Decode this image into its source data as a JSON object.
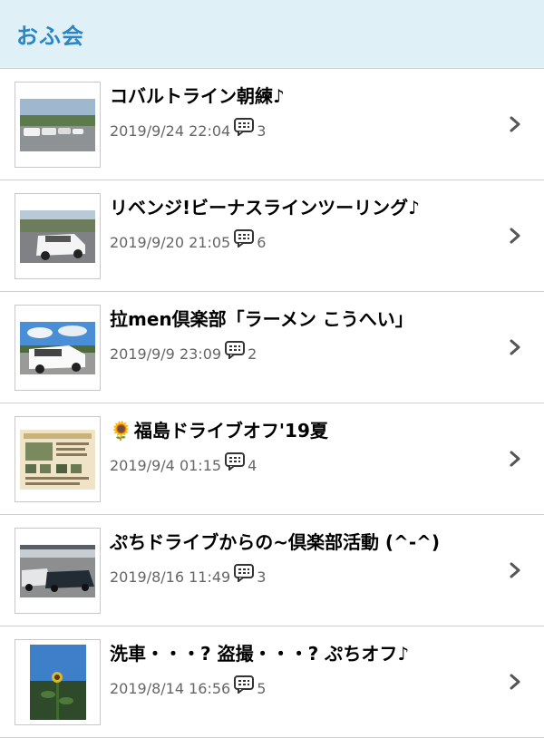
{
  "header": {
    "title": "おふ会"
  },
  "icons": {
    "comment": "comment-icon",
    "chevron": "chevron-right-icon"
  },
  "colors": {
    "header_bg": "#dff0f7",
    "header_title": "#2a86c7",
    "meta_text": "#666666"
  },
  "items": [
    {
      "title": "コバルトライン朝練♪",
      "date": "2019/9/24 22:04",
      "comments": "3"
    },
    {
      "title": "リベンジ!ビーナスラインツーリング♪",
      "date": "2019/9/20 21:05",
      "comments": "6"
    },
    {
      "title": "拉men倶楽部「ラーメン こうへい」",
      "date": "2019/9/9 23:09",
      "comments": "2"
    },
    {
      "title_prefix_icon": "sunflower-icon",
      "title": "福島ドライブオフ'19夏",
      "date": "2019/9/4 01:15",
      "comments": "4"
    },
    {
      "title": "ぷちドライブからの~倶楽部活動 (^-^)",
      "date": "2019/8/16 11:49",
      "comments": "3"
    },
    {
      "title": "洗車・・・? 盗撮・・・? ぷちオフ♪",
      "date": "2019/8/14 16:56",
      "comments": "5"
    }
  ]
}
